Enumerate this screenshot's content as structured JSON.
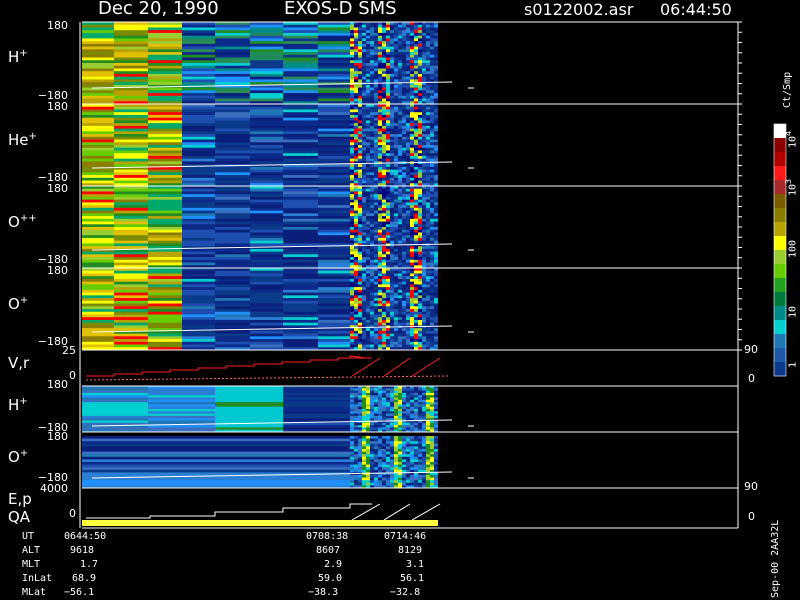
{
  "header": {
    "date": "Dec 20, 1990",
    "instrument": "EXOS-D SMS",
    "file": "s0122002.asr",
    "time": "06:44:50"
  },
  "panels": [
    {
      "species": "H",
      "charge": "+",
      "ymax": "180",
      "ymin": "−180"
    },
    {
      "species": "He",
      "charge": "+",
      "ymax": "180",
      "ymin": "−180"
    },
    {
      "species": "O",
      "charge": "++",
      "ymax": "180",
      "ymin": "−180"
    },
    {
      "species": "O",
      "charge": "+",
      "ymax": "180",
      "ymin": "−180"
    }
  ],
  "vr_panel": {
    "label": "V,r",
    "ymax": "25",
    "ymin": "0",
    "rmax": "90",
    "rmin": "0"
  },
  "lower_panels": [
    {
      "species": "H",
      "charge": "+",
      "ymax": "180",
      "ymin": "−180"
    },
    {
      "species": "O",
      "charge": "+",
      "ymax": "180",
      "ymin": "−180"
    }
  ],
  "ep_panel": {
    "label1": "E,p",
    "label2": "QA",
    "ymax": "4000",
    "ymin": "0",
    "rmax": "90",
    "rmin": "0"
  },
  "colorbar": {
    "units": "Ct/Smp",
    "ticks": [
      {
        "base": "10",
        "exp": "4"
      },
      {
        "base": "10",
        "exp": "3"
      },
      {
        "base": "100",
        "exp": ""
      },
      {
        "base": "10",
        "exp": ""
      },
      {
        "base": "1",
        "exp": ""
      }
    ],
    "colors": [
      "#ffffff",
      "#8b0000",
      "#b00000",
      "#ff1a1a",
      "#a52a2a",
      "#7a5c00",
      "#8b7d00",
      "#b8a200",
      "#ffff00",
      "#9acd32",
      "#66cc00",
      "#22a020",
      "#007a3d",
      "#008b8b",
      "#00ced1",
      "#1f77b4",
      "#1e5aa8",
      "#0b3a8a"
    ]
  },
  "ephemeris": {
    "labels": [
      "UT",
      "ALT",
      "MLT",
      "InLat",
      "MLat"
    ],
    "columns": [
      [
        "0644:50",
        "9618",
        "1.7",
        "68.9",
        "−56.1"
      ],
      [
        "0708:38",
        "8607",
        "2.9",
        "59.0",
        "−38.3"
      ],
      [
        "0714:46",
        "8129",
        "3.1",
        "56.1",
        "−32.8"
      ]
    ]
  },
  "footer_vertical": "Sep-00  2AA32L",
  "chart_data": {
    "type": "heatmap",
    "title": "Dec 20, 1990   EXOS-D SMS",
    "panels": [
      "H+",
      "He+",
      "O++",
      "O+",
      "V,r",
      "H+",
      "O+",
      "E,p QA"
    ],
    "y_range_angle": [
      -180,
      180
    ],
    "vr_range": [
      0,
      25
    ],
    "ep_range": [
      0,
      4000
    ],
    "right_axis_range": [
      0,
      90
    ],
    "colorbar_units": "Ct/Smp",
    "colorbar_range": [
      1,
      10000
    ],
    "colorbar_scale": "log",
    "ut_ticks": [
      "0644:50",
      "0708:38",
      "0714:46"
    ]
  }
}
